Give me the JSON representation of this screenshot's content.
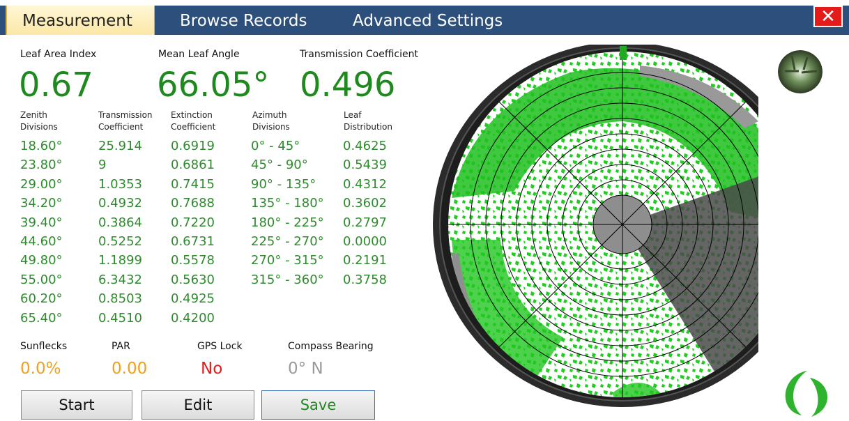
{
  "tabs": [
    "Measurement",
    "Browse Records",
    "Advanced Settings"
  ],
  "close_glyph": "✕",
  "summary": {
    "lai_label": "Leaf Area Index",
    "lai_value": "0.67",
    "mla_label": "Mean Leaf Angle",
    "mla_value": "66.05°",
    "tc_label": "Transmission Coefficient",
    "tc_value": "0.496"
  },
  "table": {
    "headers": {
      "zenith": [
        "Zenith",
        "Divisions"
      ],
      "transmission": [
        "Transmission",
        "Coefficient"
      ],
      "extinction": [
        "Extinction",
        "Coefficient"
      ],
      "azimuth": [
        "Azimuth",
        "Divisions"
      ],
      "leaf": [
        "Leaf",
        "Distribution"
      ]
    },
    "zenith": [
      "18.60°",
      "23.80°",
      "29.00°",
      "34.20°",
      "39.40°",
      "44.60°",
      "49.80°",
      "55.00°",
      "60.20°",
      "65.40°"
    ],
    "transmission": [
      "25.914",
      "9",
      "1.0353",
      "0.4932",
      "0.3864",
      "0.5252",
      "1.1899",
      "6.3432",
      "0.8503",
      "0.4510"
    ],
    "extinction": [
      "0.6919",
      "0.6861",
      "0.7415",
      "0.7688",
      "0.7220",
      "0.6731",
      "0.5578",
      "0.5630",
      "0.4925",
      "0.4200"
    ],
    "azimuth": [
      "0° - 45°",
      "45° - 90°",
      "90° - 135°",
      "135° - 180°",
      "180° - 225°",
      "225° - 270°",
      "270° - 315°",
      "315° - 360°"
    ],
    "leaf": [
      "0.4625",
      "0.5439",
      "0.4312",
      "0.3602",
      "0.2797",
      "0.0000",
      "0.2191",
      "0.3758"
    ]
  },
  "status": {
    "sunflecks_label": "Sunflecks",
    "sunflecks_value": "0.0%",
    "par_label": "PAR",
    "par_value": "0.00",
    "gps_label": "GPS Lock",
    "gps_value": "No",
    "compass_label": "Compass Bearing",
    "compass_value": "0° N"
  },
  "buttons": {
    "start": "Start",
    "edit": "Edit",
    "save": "Save"
  },
  "icons": {
    "close": "close-icon",
    "thumbnail": "canopy-photo-thumbnail",
    "logo": "leaf-logo-icon"
  },
  "colors": {
    "tab_bar": "#2c4f7b",
    "value_green": "#1e8a1e",
    "orange": "#f0a020",
    "red": "#e31b1b",
    "gray": "#9a9a9a"
  }
}
